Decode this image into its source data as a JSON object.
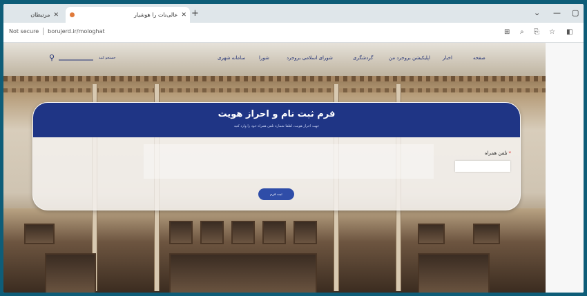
{
  "browser": {
    "tabs": [
      {
        "label": "مرتبطان"
      },
      {
        "label": "عالی‌نات را هوشیار"
      }
    ],
    "address_security": "Not secure",
    "address_url": "borujerd.ir/mologhat"
  },
  "site": {
    "nav_items": [
      "صفحه",
      "اخبار",
      "اپلیکیشن بروجرد من",
      "گردشگری",
      "شورای اسلامی بروجرد",
      "شورا",
      "سامانه شهری"
    ],
    "search_placeholder": "جستجو کنید"
  },
  "form": {
    "title": "فرم ثبت نام و احراز هویت",
    "subtitle": "جهت احراز هویت، لطفا شماره تلفن همراه خود را وارد کنید",
    "phone_label": "تلفن همراه",
    "required_mark": "*",
    "phone_value": "",
    "submit_label": "ثبت فرم"
  },
  "colors": {
    "primary": "#1f3585",
    "button": "#2f4da8",
    "frame": "#0e5d78"
  }
}
